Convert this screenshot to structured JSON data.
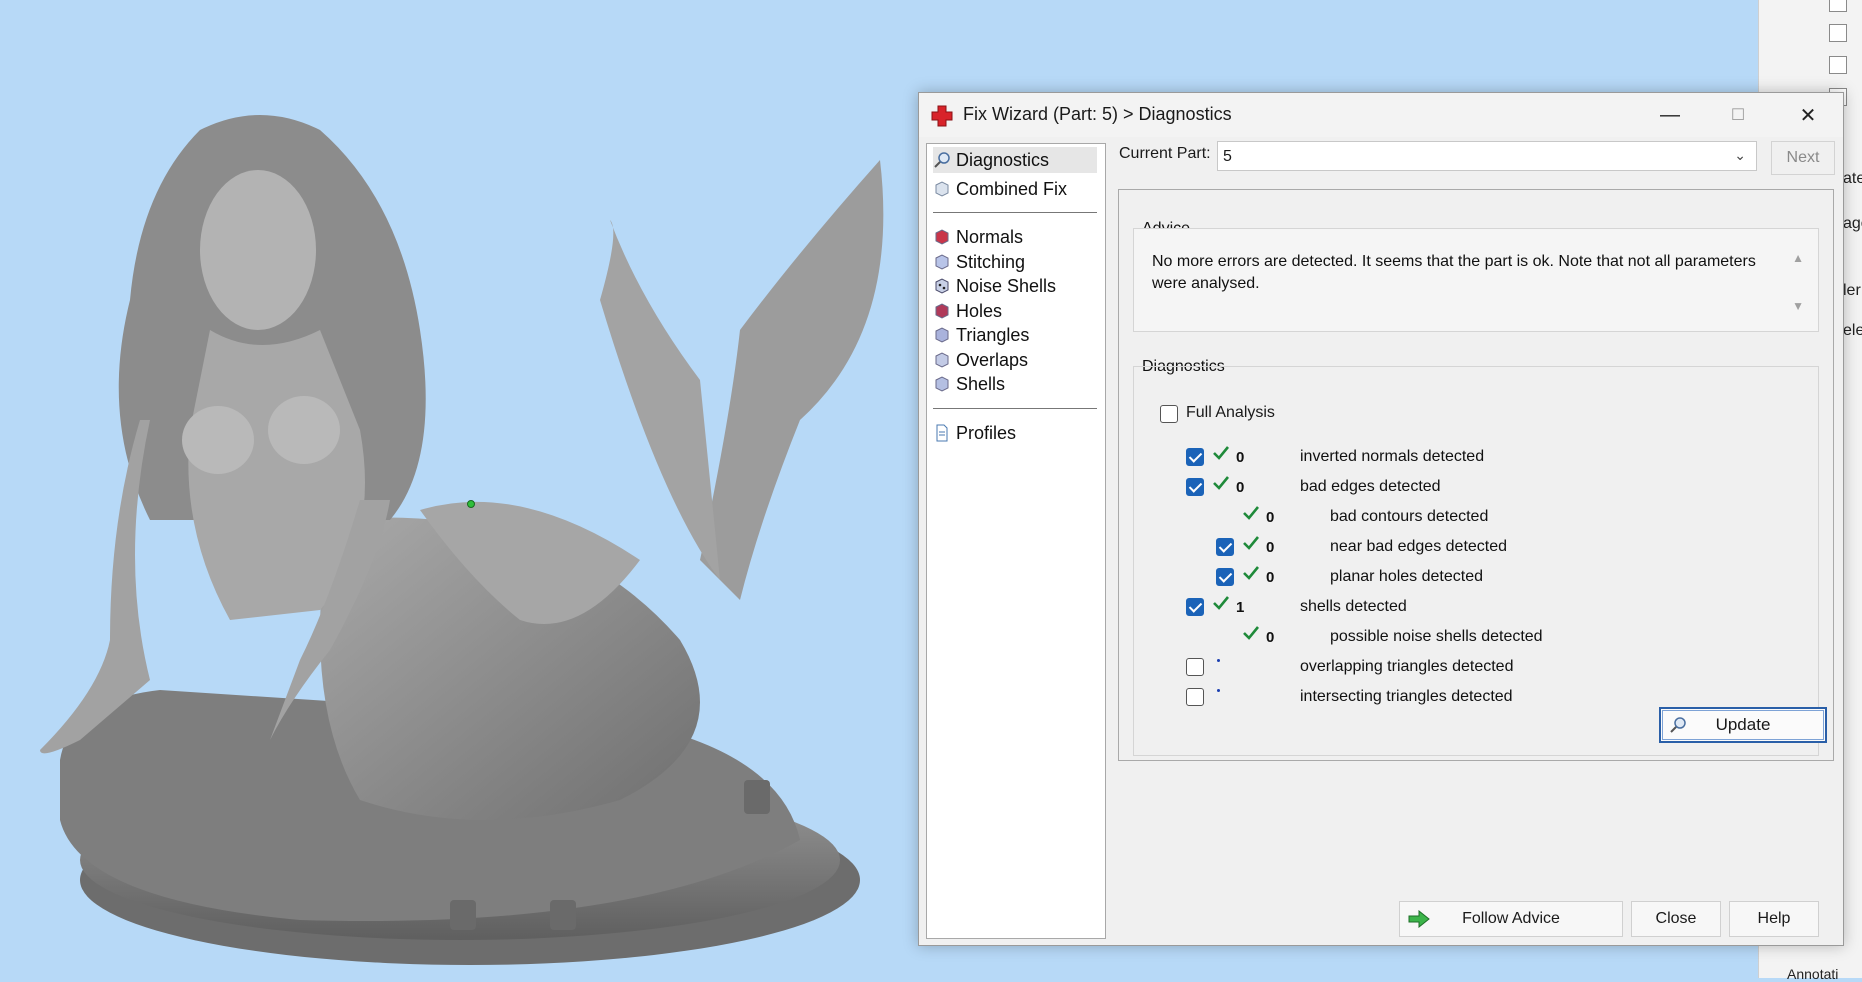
{
  "right_panel": {
    "fragments": [
      "ate",
      "age",
      "ler",
      "elec",
      "Annotati"
    ]
  },
  "dialog": {
    "title": "Fix Wizard (Part: 5) > Diagnostics",
    "window_buttons": {
      "minimize": "—",
      "maximize": "☐",
      "close": "✕"
    },
    "nav": {
      "top": [
        "Diagnostics",
        "Combined Fix"
      ],
      "middle": [
        "Normals",
        "Stitching",
        "Noise Shells",
        "Holes",
        "Triangles",
        "Overlaps",
        "Shells"
      ],
      "bottom": [
        "Profiles"
      ],
      "selected": "Diagnostics"
    },
    "current_part": {
      "label": "Current Part:",
      "value": "5"
    },
    "next_label": "Next",
    "advice": {
      "label": "Advice",
      "text": "No more errors are detected. It seems that the part is ok. Note that not all parameters were analysed."
    },
    "diagnostics": {
      "label": "Diagnostics",
      "full_analysis": {
        "label": "Full Analysis",
        "checked": false
      },
      "rows": [
        {
          "checked": true,
          "status": "ok",
          "count": "0",
          "label": "inverted normals detected"
        },
        {
          "checked": true,
          "status": "ok",
          "count": "0",
          "label": "bad edges detected"
        },
        {
          "checked": null,
          "status": "ok",
          "count": "0",
          "label": "bad contours detected"
        },
        {
          "checked": true,
          "status": "ok",
          "count": "0",
          "label": "near bad edges detected"
        },
        {
          "checked": true,
          "status": "ok",
          "count": "0",
          "label": "planar holes detected"
        },
        {
          "checked": true,
          "status": "ok",
          "count": "1",
          "label": "shells detected"
        },
        {
          "checked": null,
          "status": "ok",
          "count": "0",
          "label": "possible noise shells detected"
        },
        {
          "checked": false,
          "status": "pending",
          "count": "",
          "label": "overlapping triangles detected"
        },
        {
          "checked": false,
          "status": "pending",
          "count": "",
          "label": "intersecting triangles detected"
        }
      ],
      "update_label": "Update"
    },
    "buttons": {
      "follow_advice": "Follow Advice",
      "close": "Close",
      "help": "Help"
    }
  },
  "colors": {
    "viewport_bg": "#b7d9f7",
    "accent": "#1b63b8",
    "ok_tick": "#1f8a3a",
    "model_gray": "#8f8f8f"
  }
}
